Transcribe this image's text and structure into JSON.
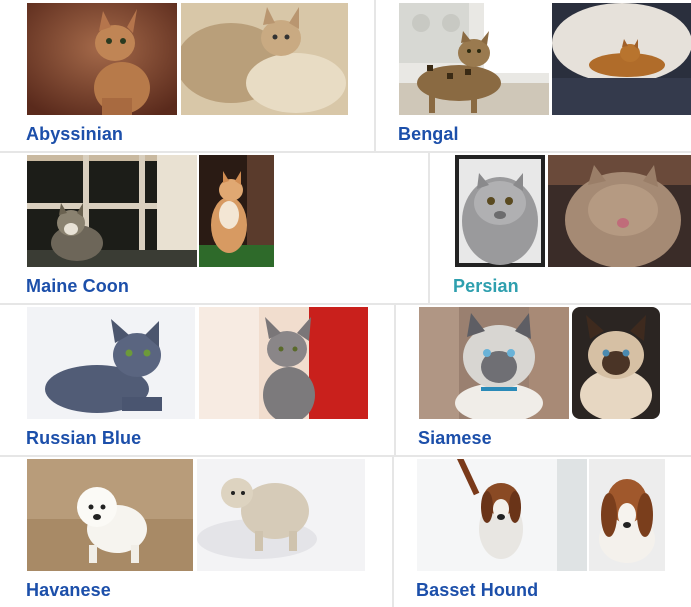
{
  "breeds": [
    {
      "name": "Abyssinian",
      "images": [
        "abyssinian-photo-1",
        "abyssinian-photo-2"
      ]
    },
    {
      "name": "Bengal",
      "images": [
        "bengal-photo-1",
        "bengal-photo-2"
      ]
    },
    {
      "name": "Maine Coon",
      "images": [
        "maine-coon-photo-1",
        "maine-coon-photo-2"
      ]
    },
    {
      "name": "Persian",
      "images": [
        "persian-photo-1",
        "persian-photo-2"
      ],
      "accent": "#2e9fae"
    },
    {
      "name": "Russian Blue",
      "images": [
        "russian-blue-photo-1",
        "russian-blue-photo-2"
      ]
    },
    {
      "name": "Siamese",
      "images": [
        "siamese-photo-1",
        "siamese-photo-2"
      ]
    },
    {
      "name": "Havanese",
      "images": [
        "havanese-photo-1",
        "havanese-photo-2"
      ]
    },
    {
      "name": "Basset Hound",
      "images": [
        "basset-hound-photo-1",
        "basset-hound-photo-2"
      ]
    }
  ],
  "colors": {
    "label": "#1c4faa",
    "hover_label": "#2e9fae",
    "divider": "#e6e6e6"
  }
}
